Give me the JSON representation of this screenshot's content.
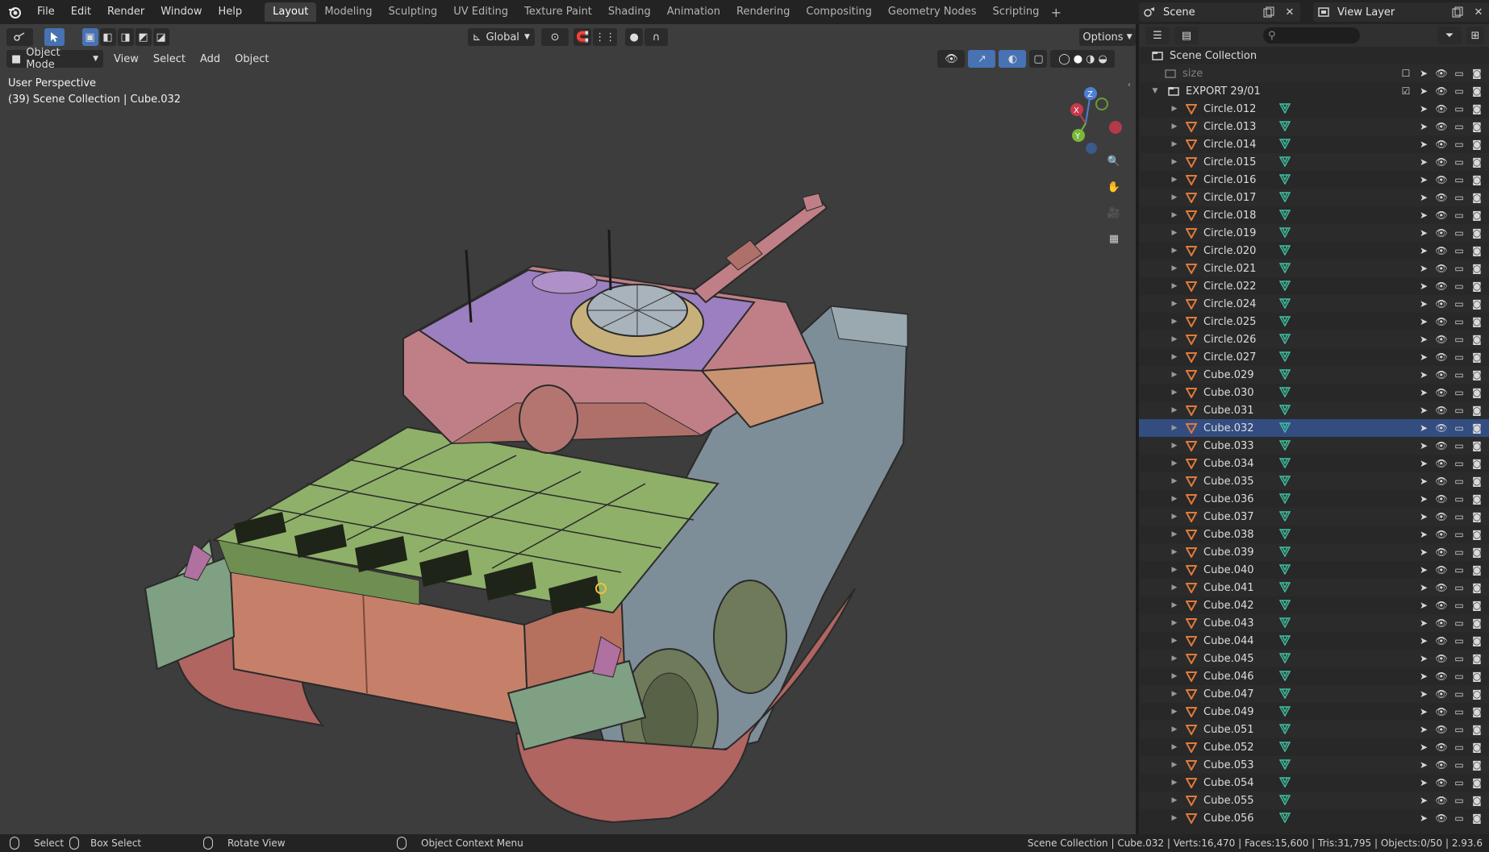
{
  "menu": [
    "File",
    "Edit",
    "Render",
    "Window",
    "Help"
  ],
  "workspaces": [
    "Layout",
    "Modeling",
    "Sculpting",
    "UV Editing",
    "Texture Paint",
    "Shading",
    "Animation",
    "Rendering",
    "Compositing",
    "Geometry Nodes",
    "Scripting"
  ],
  "active_workspace": "Layout",
  "scene_name": "Scene",
  "view_layer": "View Layer",
  "viewport": {
    "mode": "Object Mode",
    "menus": [
      "View",
      "Select",
      "Add",
      "Object"
    ],
    "transform_orientation": "Global",
    "options_label": "Options",
    "overlay_line1": "User Perspective",
    "overlay_line2": "(39) Scene Collection | Cube.032",
    "gizmo_axes": {
      "z": "Z",
      "y": "Y",
      "x": "X"
    }
  },
  "outliner": {
    "root": "Scene Collection",
    "size_item": "size",
    "collection": "EXPORT 29/01",
    "objects": [
      "Circle.012",
      "Circle.013",
      "Circle.014",
      "Circle.015",
      "Circle.016",
      "Circle.017",
      "Circle.018",
      "Circle.019",
      "Circle.020",
      "Circle.021",
      "Circle.022",
      "Circle.024",
      "Circle.025",
      "Circle.026",
      "Circle.027",
      "Cube.029",
      "Cube.030",
      "Cube.031",
      "Cube.032",
      "Cube.033",
      "Cube.034",
      "Cube.035",
      "Cube.036",
      "Cube.037",
      "Cube.038",
      "Cube.039",
      "Cube.040",
      "Cube.041",
      "Cube.042",
      "Cube.043",
      "Cube.044",
      "Cube.045",
      "Cube.046",
      "Cube.047",
      "Cube.049",
      "Cube.051",
      "Cube.052",
      "Cube.053",
      "Cube.054",
      "Cube.055",
      "Cube.056"
    ],
    "active_object": "Cube.032"
  },
  "statusbar": {
    "select": "Select",
    "box_select": "Box Select",
    "rotate_view": "Rotate View",
    "context_menu": "Object Context Menu",
    "stats": "Scene Collection | Cube.032 | Verts:16,470 | Faces:15,600 | Tris:31,795 | Objects:0/50 | 2.93.6"
  },
  "colors": {
    "accent": "#4772b3",
    "object_orange": "#e07a3a",
    "mesh_green": "#3fbf9f",
    "turret_pink": "#b87a7a",
    "deck_green": "#8aa85a"
  }
}
